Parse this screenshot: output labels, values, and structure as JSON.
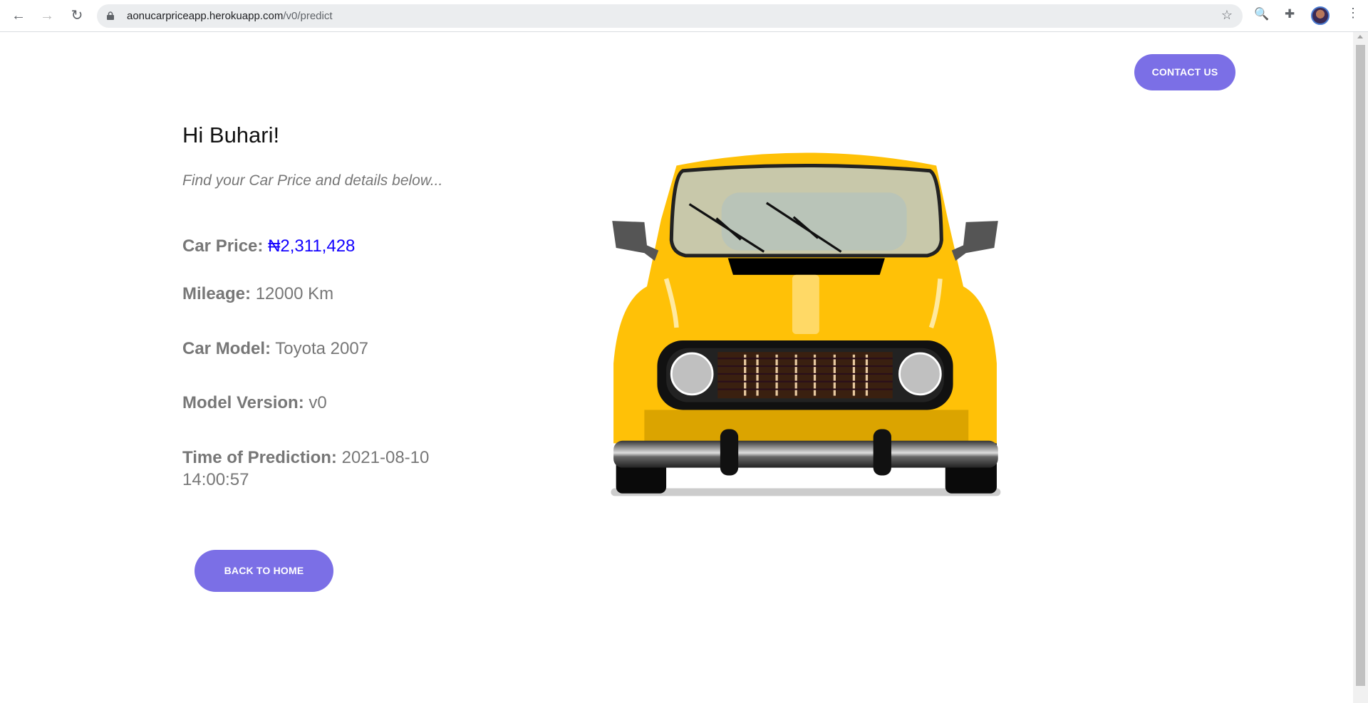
{
  "browser": {
    "url_host": "aonucarpriceapp.herokuapp.com",
    "url_path": "/v0/predict",
    "icons": [
      "back-arrow-icon",
      "forward-arrow-icon",
      "reload-icon",
      "lock-icon",
      "bookmark-star-icon",
      "extension-icon",
      "puzzle-icon",
      "avatar",
      "kebab-menu-icon"
    ]
  },
  "header": {
    "contact_label": "CONTACT US"
  },
  "main": {
    "greeting": "Hi Buhari!",
    "subtitle": "Find your Car Price and details below...",
    "details": [
      {
        "label": "Car Price:",
        "value": "₦2,311,428"
      },
      {
        "label": "Mileage:",
        "value": "12000 Km"
      },
      {
        "label": "Car Model:",
        "value": "Toyota 2007"
      },
      {
        "label": "Model Version:",
        "value": "v0"
      },
      {
        "label": "Time of Prediction:",
        "value": "2021-08-10 14:00:57"
      }
    ],
    "back_label": "BACK TO HOME"
  },
  "colors": {
    "accent": "#7b6fe6",
    "price": "#1200ff",
    "car_body": "#ffc107"
  }
}
